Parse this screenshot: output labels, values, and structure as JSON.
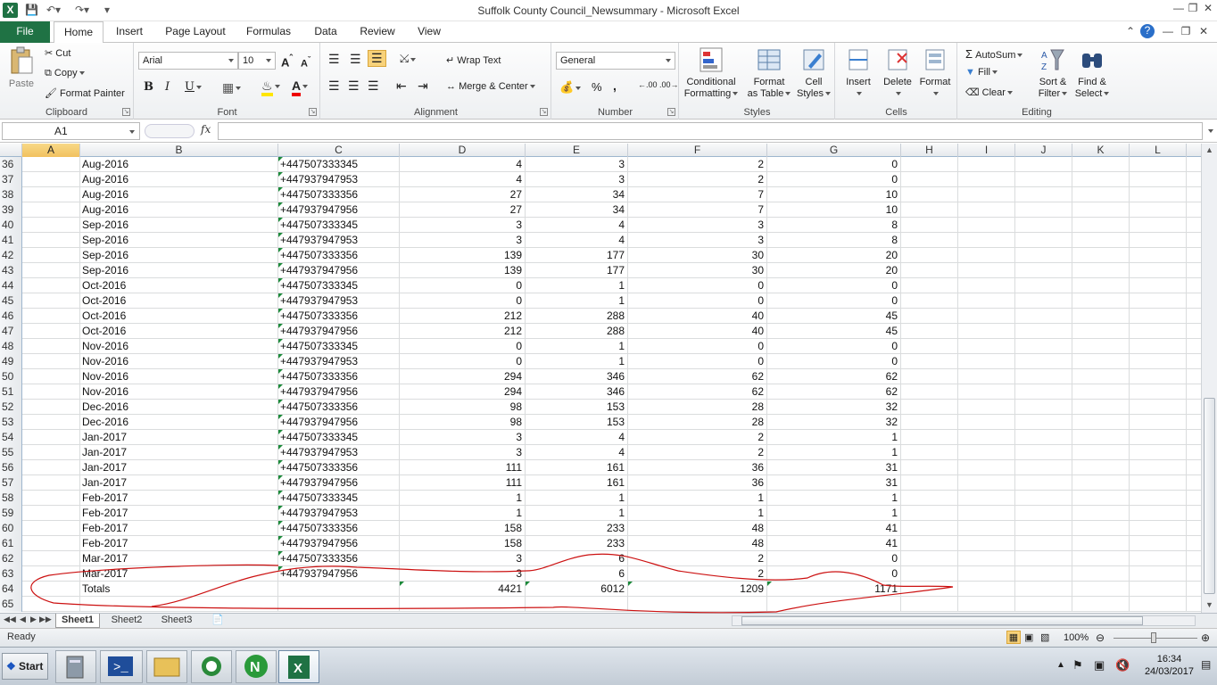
{
  "window": {
    "title": "Suffolk County Council_Newsummary  -  Microsoft Excel"
  },
  "tabs": [
    "File",
    "Home",
    "Insert",
    "Page Layout",
    "Formulas",
    "Data",
    "Review",
    "View"
  ],
  "ribbon": {
    "clipboard": {
      "label": "Clipboard",
      "paste": "Paste",
      "cut": "Cut",
      "copy": "Copy",
      "format_painter": "Format Painter"
    },
    "font": {
      "label": "Font",
      "font_name": "Arial",
      "font_size": "10",
      "bold": "B",
      "italic": "I",
      "underline": "U"
    },
    "alignment": {
      "label": "Alignment",
      "wrap_text": "Wrap Text",
      "merge_center": "Merge & Center"
    },
    "number": {
      "label": "Number",
      "format": "General",
      "percent": "%",
      "comma": ","
    },
    "styles": {
      "label": "Styles",
      "conditional": "Conditional",
      "formatting": "Formatting",
      "format_as": "Format",
      "as_table": "as Table",
      "cell": "Cell",
      "styles": "Styles"
    },
    "cells": {
      "label": "Cells",
      "insert": "Insert",
      "delete": "Delete",
      "format": "Format"
    },
    "editing": {
      "label": "Editing",
      "autosum": "AutoSum",
      "fill": "Fill",
      "clear": "Clear",
      "sort1": "Sort &",
      "sort2": "Filter",
      "find1": "Find &",
      "find2": "Select"
    }
  },
  "formula_bar": {
    "name_box": "A1",
    "fx": "fx",
    "value": ""
  },
  "columns": [
    "A",
    "B",
    "C",
    "D",
    "E",
    "F",
    "G",
    "H",
    "I",
    "J",
    "K",
    "L"
  ],
  "rows": [
    {
      "n": "36",
      "b": "Aug-2016",
      "c": "+447507333345",
      "d": "4",
      "e": "3",
      "f": "2",
      "g": "0"
    },
    {
      "n": "37",
      "b": "Aug-2016",
      "c": "+447937947953",
      "d": "4",
      "e": "3",
      "f": "2",
      "g": "0"
    },
    {
      "n": "38",
      "b": "Aug-2016",
      "c": "+447507333356",
      "d": "27",
      "e": "34",
      "f": "7",
      "g": "10"
    },
    {
      "n": "39",
      "b": "Aug-2016",
      "c": "+447937947956",
      "d": "27",
      "e": "34",
      "f": "7",
      "g": "10"
    },
    {
      "n": "40",
      "b": "Sep-2016",
      "c": "+447507333345",
      "d": "3",
      "e": "4",
      "f": "3",
      "g": "8"
    },
    {
      "n": "41",
      "b": "Sep-2016",
      "c": "+447937947953",
      "d": "3",
      "e": "4",
      "f": "3",
      "g": "8"
    },
    {
      "n": "42",
      "b": "Sep-2016",
      "c": "+447507333356",
      "d": "139",
      "e": "177",
      "f": "30",
      "g": "20"
    },
    {
      "n": "43",
      "b": "Sep-2016",
      "c": "+447937947956",
      "d": "139",
      "e": "177",
      "f": "30",
      "g": "20"
    },
    {
      "n": "44",
      "b": "Oct-2016",
      "c": "+447507333345",
      "d": "0",
      "e": "1",
      "f": "0",
      "g": "0"
    },
    {
      "n": "45",
      "b": "Oct-2016",
      "c": "+447937947953",
      "d": "0",
      "e": "1",
      "f": "0",
      "g": "0"
    },
    {
      "n": "46",
      "b": "Oct-2016",
      "c": "+447507333356",
      "d": "212",
      "e": "288",
      "f": "40",
      "g": "45"
    },
    {
      "n": "47",
      "b": "Oct-2016",
      "c": "+447937947956",
      "d": "212",
      "e": "288",
      "f": "40",
      "g": "45"
    },
    {
      "n": "48",
      "b": "Nov-2016",
      "c": "+447507333345",
      "d": "0",
      "e": "1",
      "f": "0",
      "g": "0"
    },
    {
      "n": "49",
      "b": "Nov-2016",
      "c": "+447937947953",
      "d": "0",
      "e": "1",
      "f": "0",
      "g": "0"
    },
    {
      "n": "50",
      "b": "Nov-2016",
      "c": "+447507333356",
      "d": "294",
      "e": "346",
      "f": "62",
      "g": "62"
    },
    {
      "n": "51",
      "b": "Nov-2016",
      "c": "+447937947956",
      "d": "294",
      "e": "346",
      "f": "62",
      "g": "62"
    },
    {
      "n": "52",
      "b": "Dec-2016",
      "c": "+447507333356",
      "d": "98",
      "e": "153",
      "f": "28",
      "g": "32"
    },
    {
      "n": "53",
      "b": "Dec-2016",
      "c": "+447937947956",
      "d": "98",
      "e": "153",
      "f": "28",
      "g": "32"
    },
    {
      "n": "54",
      "b": "Jan-2017",
      "c": "+447507333345",
      "d": "3",
      "e": "4",
      "f": "2",
      "g": "1"
    },
    {
      "n": "55",
      "b": "Jan-2017",
      "c": "+447937947953",
      "d": "3",
      "e": "4",
      "f": "2",
      "g": "1"
    },
    {
      "n": "56",
      "b": "Jan-2017",
      "c": "+447507333356",
      "d": "111",
      "e": "161",
      "f": "36",
      "g": "31"
    },
    {
      "n": "57",
      "b": "Jan-2017",
      "c": "+447937947956",
      "d": "111",
      "e": "161",
      "f": "36",
      "g": "31"
    },
    {
      "n": "58",
      "b": "Feb-2017",
      "c": "+447507333345",
      "d": "1",
      "e": "1",
      "f": "1",
      "g": "1"
    },
    {
      "n": "59",
      "b": "Feb-2017",
      "c": "+447937947953",
      "d": "1",
      "e": "1",
      "f": "1",
      "g": "1"
    },
    {
      "n": "60",
      "b": "Feb-2017",
      "c": "+447507333356",
      "d": "158",
      "e": "233",
      "f": "48",
      "g": "41"
    },
    {
      "n": "61",
      "b": "Feb-2017",
      "c": "+447937947956",
      "d": "158",
      "e": "233",
      "f": "48",
      "g": "41"
    },
    {
      "n": "62",
      "b": "Mar-2017",
      "c": "+447507333356",
      "d": "3",
      "e": "6",
      "f": "2",
      "g": "0"
    },
    {
      "n": "63",
      "b": "Mar-2017",
      "c": "+447937947956",
      "d": "3",
      "e": "6",
      "f": "2",
      "g": "0"
    },
    {
      "n": "64",
      "b": "Totals",
      "c": "",
      "d": "4421",
      "e": "6012",
      "f": "1209",
      "g": "1171"
    },
    {
      "n": "65",
      "b": "",
      "c": "",
      "d": "",
      "e": "",
      "f": "",
      "g": ""
    }
  ],
  "sheets": [
    "Sheet1",
    "Sheet2",
    "Sheet3"
  ],
  "status": {
    "ready": "Ready",
    "zoom": "100%"
  },
  "taskbar": {
    "start": "Start",
    "time": "16:34",
    "date": "24/03/2017"
  },
  "colors": {
    "excel_green": "#1f7244",
    "annotation": "#d01a1a",
    "selected_header": "#f1c15f"
  }
}
